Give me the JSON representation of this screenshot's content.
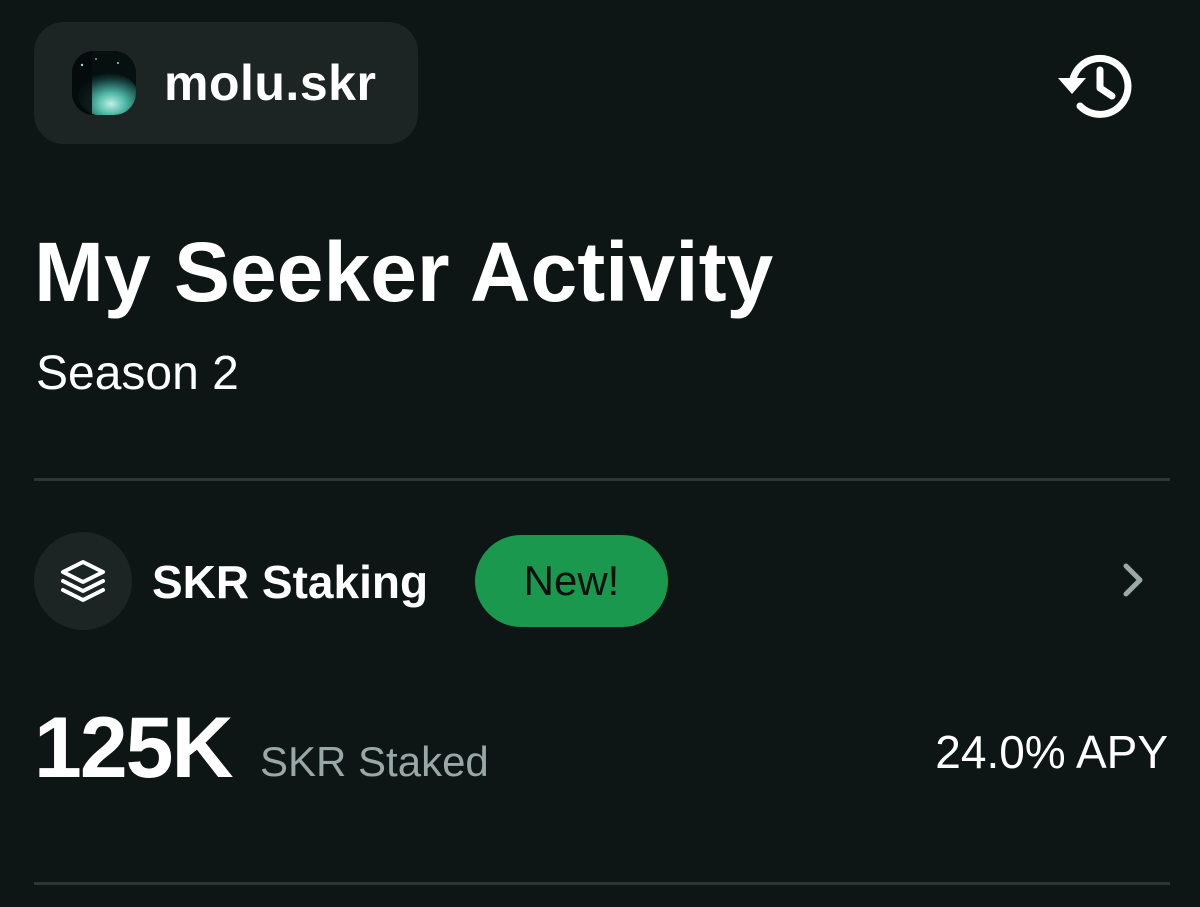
{
  "account": {
    "name": "molu.skr",
    "avatar_icon": "astronaut-avatar"
  },
  "header": {
    "history_icon": "history-icon"
  },
  "page": {
    "title": "My Seeker Activity",
    "subtitle": "Season 2"
  },
  "staking": {
    "icon": "layers-icon",
    "label": "SKR Staking",
    "badge": "New!",
    "amount": "125K",
    "amount_label": "SKR Staked",
    "apy": "24.0% APY"
  },
  "colors": {
    "background": "#0e1615",
    "surface": "#1d2524",
    "badge_green": "#1a994e",
    "muted_text": "#98a8a6",
    "divider": "#2b3736"
  }
}
